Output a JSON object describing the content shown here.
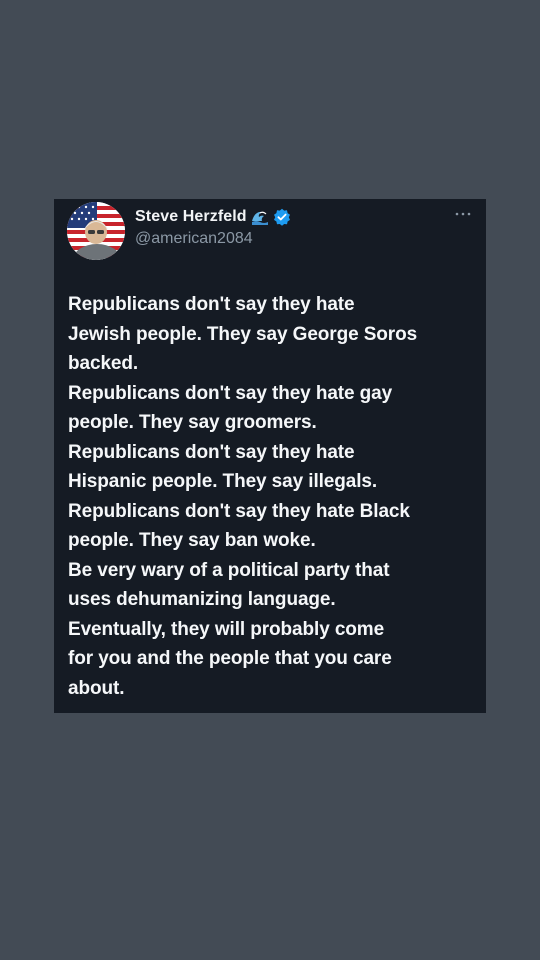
{
  "tweet": {
    "author": {
      "display_name": "Steve Herzfeld",
      "handle": "@american2084",
      "avatar_icon": "avatar-flag-photo",
      "badge_icons": [
        "wave-emoji-icon",
        "verified-badge-icon"
      ]
    },
    "more_icon": "more-options-icon",
    "body_lines": [
      "Republicans don't say they hate",
      "Jewish people. They say George Soros",
      "backed.",
      "Republicans don't say they hate gay",
      "people. They say groomers.",
      "Republicans don't say they hate",
      "Hispanic people. They say illegals.",
      "Republicans don't say they hate Black",
      "people. They say ban woke.",
      "Be very wary of a political party that",
      "uses dehumanizing language.",
      "Eventually, they will probably come",
      "for you and the people that you care",
      "about."
    ]
  },
  "colors": {
    "page_background": "#434b55",
    "card_background": "#151b24",
    "text_primary": "#f5f7f9",
    "text_secondary": "#8b98a5",
    "verified_blue": "#1d9bf0"
  }
}
